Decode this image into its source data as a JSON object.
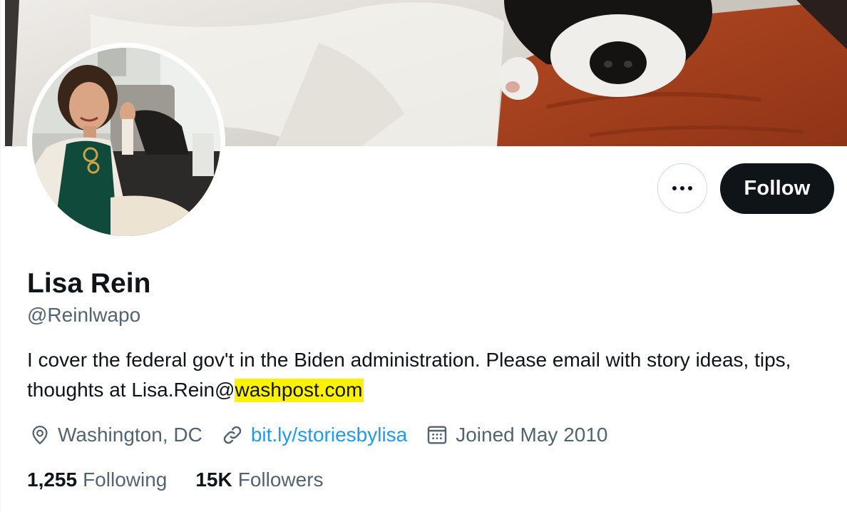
{
  "profile": {
    "name": "Lisa Rein",
    "handle": "@Reinlwapo",
    "bio_prefix": "I cover the federal gov't in the Biden administration. Please email with story ideas, tips, thoughts at Lisa.Rein@",
    "bio_highlight": "washpost.com",
    "location": "Washington, DC",
    "website": "bit.ly/storiesbylisa",
    "joined": "Joined May 2010"
  },
  "stats": {
    "following_count": "1,255",
    "following_label": "Following",
    "followers_count": "15K",
    "followers_label": "Followers"
  },
  "actions": {
    "follow_label": "Follow",
    "more_icon": "more-horizontal-icon"
  },
  "icons": {
    "location": "location-pin-icon",
    "link": "link-icon",
    "calendar": "calendar-icon"
  },
  "colors": {
    "text_primary": "#0f1419",
    "text_secondary": "#536471",
    "link": "#1d9bf0",
    "follow_bg": "#0f1419",
    "highlight": "#fff200"
  }
}
